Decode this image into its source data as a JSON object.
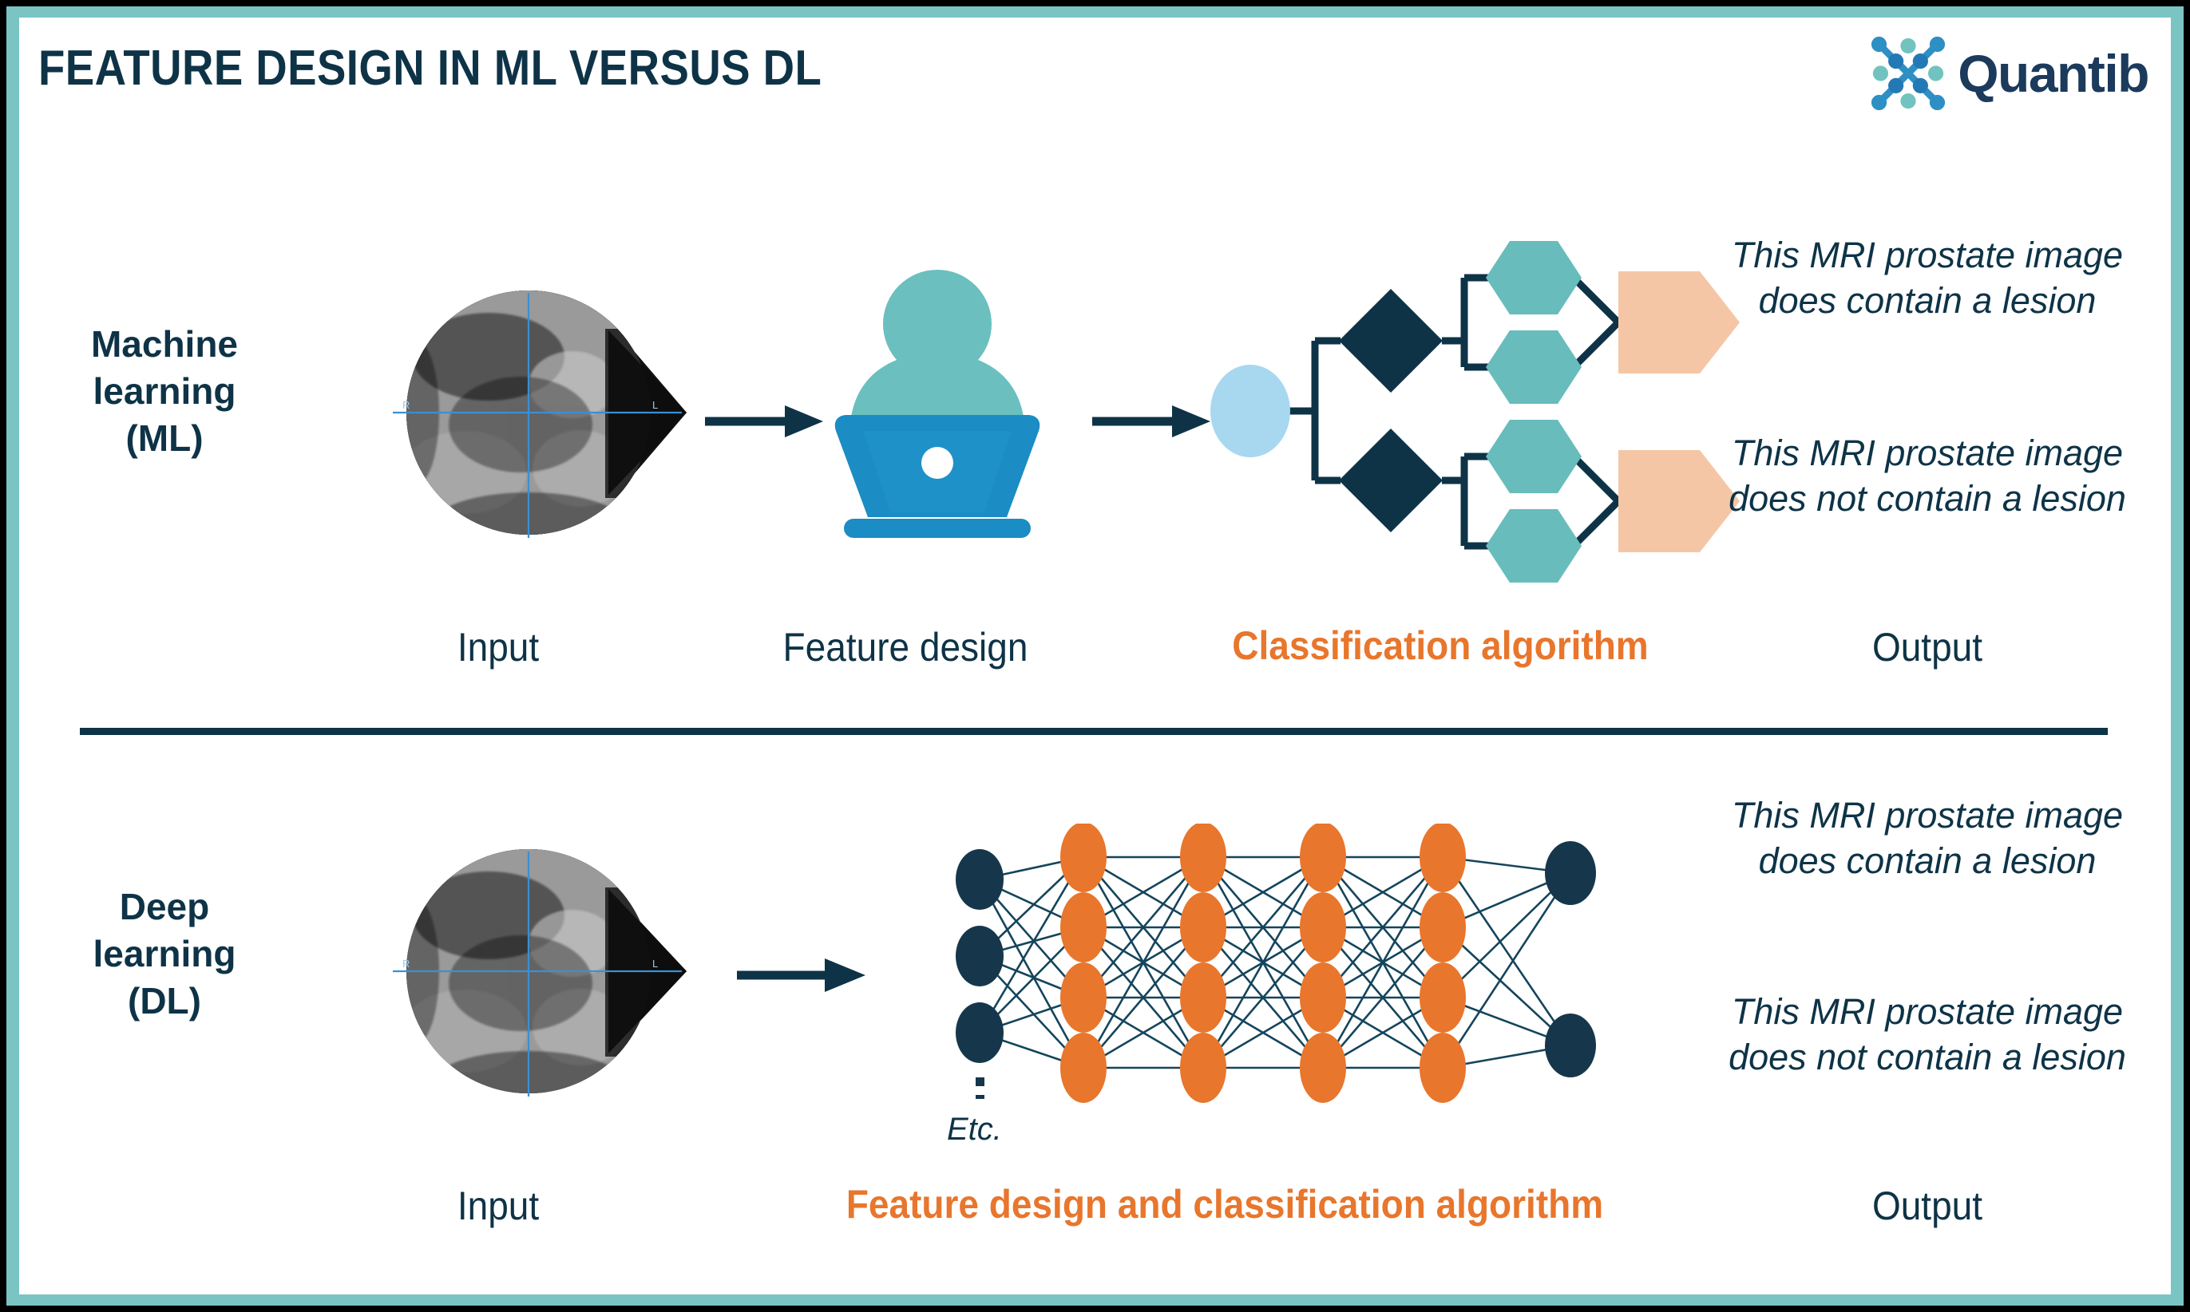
{
  "header": {
    "title": "FEATURE DESIGN IN ML VERSUS DL",
    "logo_wordmark": "Quantib",
    "logo_icon": "quantib-network-logo-icon"
  },
  "colors": {
    "dark_navy": "#0E3347",
    "accent_orange": "#E8762C",
    "teal": "#68BCBC",
    "light_teal_border": "#7BC4C4",
    "laptop_blue": "#1B8CC4",
    "person_teal": "#6BBFBF",
    "light_blue_node": "#A8D8F0",
    "peach": "#F5C6A5",
    "background": "#FFFFFF",
    "frame_black": "#000000"
  },
  "rows": [
    {
      "id": "machine-learning",
      "label": "Machine\nlearning\n(ML)",
      "label_lines": [
        "Machine",
        "learning",
        "(ML)"
      ],
      "captions": {
        "input": "Input",
        "feature": "Feature design",
        "classifier": "Classification algorithm",
        "output": "Output"
      },
      "input_image": {
        "type": "mri-prostate-axial",
        "orientation_left_marker": "R",
        "orientation_right_marker": "L"
      },
      "feature_icon": "person-at-laptop-icon",
      "classifier_diagram": {
        "type": "decision-tree",
        "root_nodes": 1,
        "decision_nodes": 2,
        "leaf_nodes": 4,
        "result_nodes": 2
      },
      "outputs": [
        "This MRI prostate image does contain a lesion",
        "This MRI prostate image does not contain a lesion"
      ]
    },
    {
      "id": "deep-learning",
      "label": "Deep\nlearning\n(DL)",
      "label_lines": [
        "Deep",
        "learning",
        "(DL)"
      ],
      "captions": {
        "input": "Input",
        "feature_and_classifier": "Feature design and classification algorithm",
        "output": "Output"
      },
      "input_image": {
        "type": "mri-prostate-axial",
        "orientation_left_marker": "R",
        "orientation_right_marker": "L"
      },
      "network_diagram": {
        "type": "fully-connected-neural-network",
        "input_nodes": 3,
        "hidden_layers": 4,
        "nodes_per_hidden_layer": 4,
        "output_nodes": 2,
        "continuation_label": "Etc."
      },
      "outputs": [
        "This MRI prostate image does contain a lesion",
        "This MRI prostate image does not contain a lesion"
      ]
    }
  ]
}
